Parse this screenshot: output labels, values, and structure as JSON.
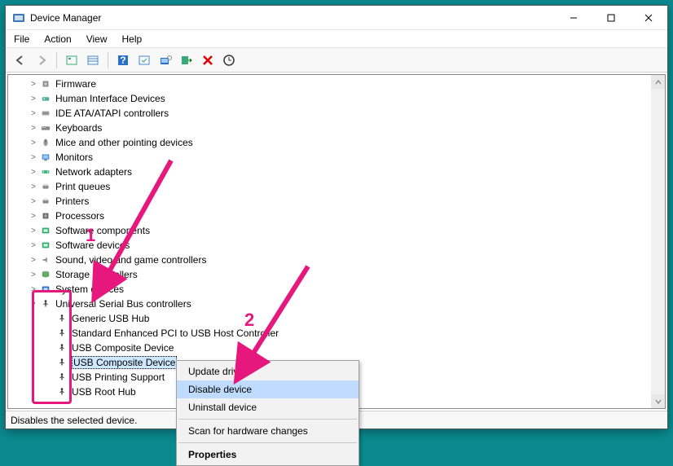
{
  "window": {
    "title": "Device Manager"
  },
  "menu": {
    "file": "File",
    "action": "Action",
    "view": "View",
    "help": "Help"
  },
  "status": "Disables the selected device.",
  "categories": [
    {
      "label": "Firmware",
      "icon": "chip"
    },
    {
      "label": "Human Interface Devices",
      "icon": "hid"
    },
    {
      "label": "IDE ATA/ATAPI controllers",
      "icon": "ide"
    },
    {
      "label": "Keyboards",
      "icon": "keyboard"
    },
    {
      "label": "Mice and other pointing devices",
      "icon": "mouse"
    },
    {
      "label": "Monitors",
      "icon": "monitor"
    },
    {
      "label": "Network adapters",
      "icon": "net"
    },
    {
      "label": "Print queues",
      "icon": "printer"
    },
    {
      "label": "Printers",
      "icon": "printer"
    },
    {
      "label": "Processors",
      "icon": "cpu"
    },
    {
      "label": "Software components",
      "icon": "sw"
    },
    {
      "label": "Software devices",
      "icon": "sw"
    },
    {
      "label": "Sound, video and game controllers",
      "icon": "sound"
    },
    {
      "label": "Storage controllers",
      "icon": "storage"
    },
    {
      "label": "System devices",
      "icon": "system"
    }
  ],
  "usb_category": "Universal Serial Bus controllers",
  "usb_devices": [
    "Generic USB Hub",
    "Standard Enhanced PCI to USB Host Controller",
    "USB Composite Device",
    "USB Composite Device",
    "USB Printing Support",
    "USB Root Hub"
  ],
  "usb_selected_index": 3,
  "context_menu": {
    "update": "Update driver",
    "disable": "Disable device",
    "uninstall": "Uninstall device",
    "scan": "Scan for hardware changes",
    "properties": "Properties"
  },
  "callouts": {
    "one": "1",
    "two": "2"
  }
}
